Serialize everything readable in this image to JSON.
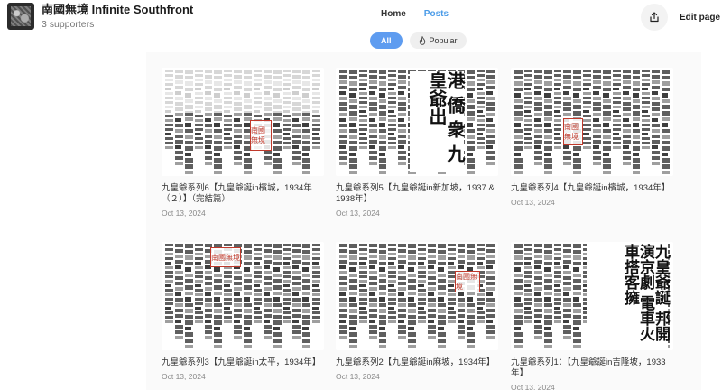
{
  "header": {
    "title": "南國無境 Infinite Southfront",
    "supporters": "3 supporters",
    "nav": [
      {
        "label": "Home",
        "active": false
      },
      {
        "label": "Posts",
        "active": true
      }
    ],
    "share_icon": "share-icon",
    "edit_label": "Edit page"
  },
  "filters": {
    "all_label": "All",
    "popular_label": "Popular",
    "popular_icon": "flame-icon",
    "accent": "#5e9cf0"
  },
  "posts": [
    {
      "title": "九皇爺系列6【九皇爺誕in檳城，1934年（２）】（完結篇）",
      "date": "Oct 13, 2024",
      "seal_text": "南國無境"
    },
    {
      "title": "九皇爺系列5【九皇爺誕in新加坡，1937 & 1938年】",
      "date": "Oct 13, 2024",
      "headline": "港 僑 衆 九皇爺出"
    },
    {
      "title": "九皇爺系列4【九皇爺誕in檳城，1934年】",
      "date": "Oct 13, 2024",
      "seal_text": "南國無境"
    },
    {
      "title": "九皇爺系列3【九皇爺誕in太平，1934年】",
      "date": "Oct 13, 2024",
      "seal_text": "南國無境"
    },
    {
      "title": "九皇爺系列2【九皇爺誕in麻坡，1934年】",
      "date": "Oct 13, 2024",
      "seal_text": "南國無境"
    },
    {
      "title": "九皇爺系列1：【九皇爺誕in吉隆坡，1933年】",
      "date": "Oct 13, 2024",
      "headline": "九皇爺誕 邦開演京劇 電車火車搭客擁"
    }
  ]
}
